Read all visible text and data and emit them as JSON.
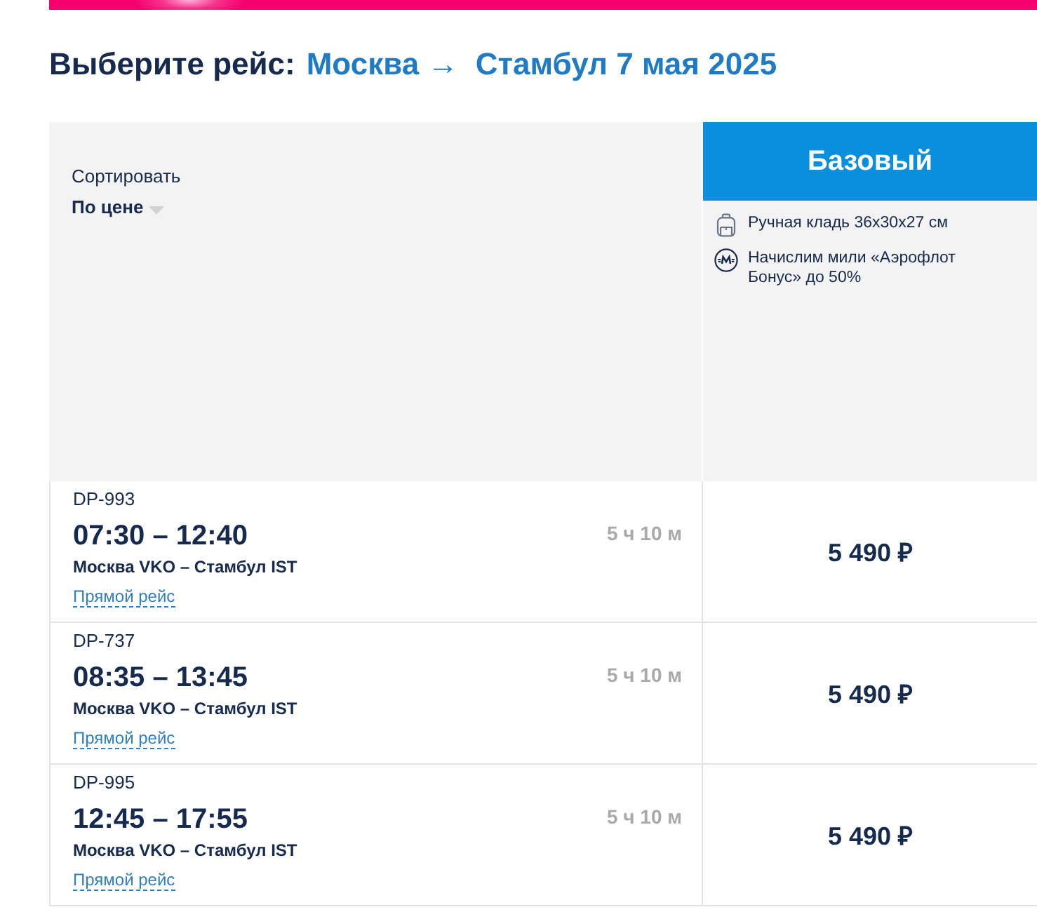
{
  "heading": {
    "label": "Выберите рейс:",
    "route": "Москва →  Стамбул 7 мая 2025"
  },
  "sort": {
    "label": "Сортировать",
    "value": "По цене"
  },
  "fare": {
    "name": "Базовый",
    "features": [
      {
        "kind": "baggage",
        "text": "Ручная кладь 36x30x27 см"
      },
      {
        "kind": "miles",
        "text": "Начислим мили «Аэрофлот Бонус» до 50%"
      }
    ]
  },
  "flights": [
    {
      "number": "DP-993",
      "times": "07:30 – 12:40",
      "route": "Москва VKO – Стамбул IST",
      "type": "Прямой рейс",
      "duration": "5 ч 10 м",
      "price": "5 490 ₽"
    },
    {
      "number": "DP-737",
      "times": "08:35 – 13:45",
      "route": "Москва VKO – Стамбул IST",
      "type": "Прямой рейс",
      "duration": "5 ч 10 м",
      "price": "5 490 ₽"
    },
    {
      "number": "DP-995",
      "times": "12:45 – 17:55",
      "route": "Москва VKO – Стамбул IST",
      "type": "Прямой рейс",
      "duration": "5 ч 10 м",
      "price": "5 490 ₽"
    }
  ]
}
